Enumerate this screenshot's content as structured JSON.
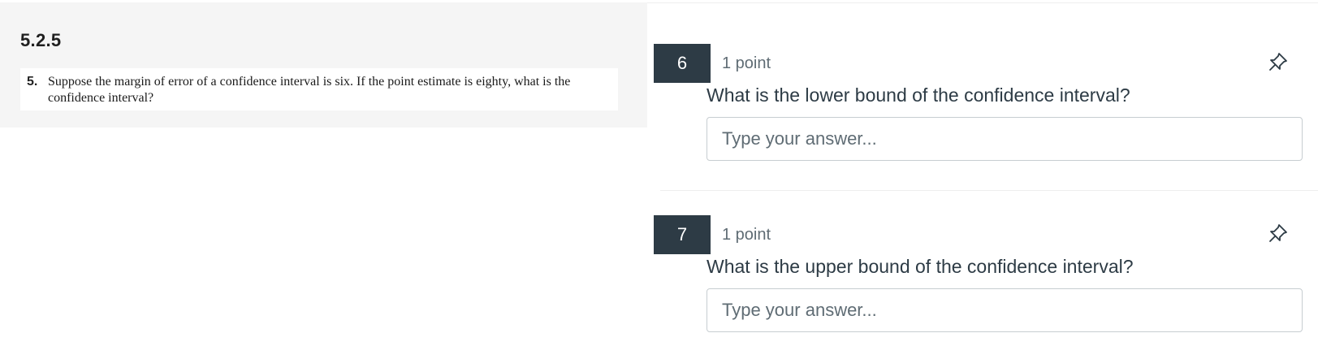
{
  "stimulus": {
    "title": "5.2.5",
    "problem_number": "5.",
    "problem_text": "Suppose the margin of error of a confidence interval is six. If the point estimate is eighty, what is the confidence interval?"
  },
  "questions": [
    {
      "number": "6",
      "points": "1 point",
      "text": "What is the lower bound of the confidence interval?",
      "answer_placeholder": "Type your answer...",
      "answer_value": "",
      "icon": "pin-icon"
    },
    {
      "number": "7",
      "points": "1 point",
      "text": "What is the upper bound of the confidence interval?",
      "answer_placeholder": "Type your answer...",
      "answer_value": "",
      "icon": "pin-icon"
    }
  ],
  "colors": {
    "number_badge_bg": "#2d3b45",
    "text_primary": "#2d3b45",
    "text_secondary": "#5f6c74",
    "stimulus_bg": "#f5f5f5",
    "input_border": "#c7cdd1"
  }
}
